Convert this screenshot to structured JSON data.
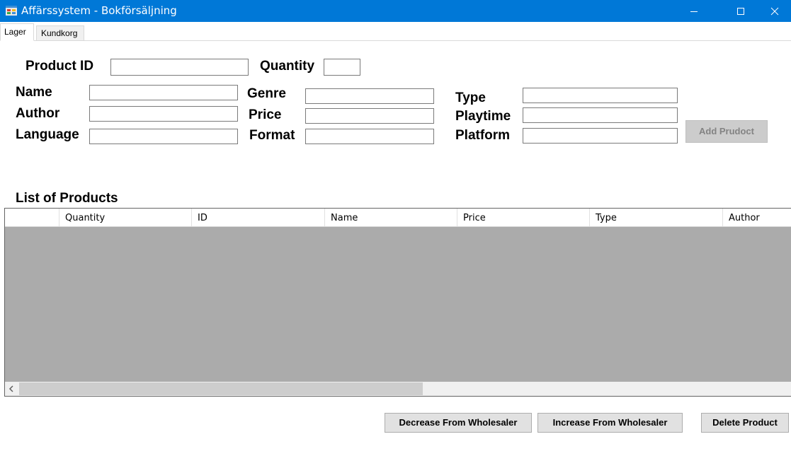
{
  "window": {
    "title": "Affärssystem - Bokförsäljning",
    "icon": "app-form-icon",
    "controls": [
      "minimize-icon",
      "maximize-icon",
      "close-icon"
    ]
  },
  "tabs": [
    {
      "label": "Lager",
      "active": true
    },
    {
      "label": "Kundkorg",
      "active": false
    }
  ],
  "form": {
    "product_id": {
      "label": "Product ID",
      "value": ""
    },
    "quantity": {
      "label": "Quantity",
      "value": ""
    },
    "name": {
      "label": "Name",
      "value": ""
    },
    "author": {
      "label": "Author",
      "value": ""
    },
    "language": {
      "label": "Language",
      "value": ""
    },
    "genre": {
      "label": "Genre",
      "value": ""
    },
    "price": {
      "label": "Price",
      "value": ""
    },
    "format": {
      "label": "Format",
      "value": ""
    },
    "type": {
      "label": "Type",
      "value": ""
    },
    "playtime": {
      "label": "Playtime",
      "value": ""
    },
    "platform": {
      "label": "Platform",
      "value": ""
    },
    "add_button": "Add Prudoct"
  },
  "products": {
    "heading": "List of Products",
    "columns": [
      "",
      "Quantity",
      "ID",
      "Name",
      "Price",
      "Type",
      "Author"
    ],
    "rows": []
  },
  "actions": {
    "decrease": "Decrease From Wholesaler",
    "increase": "Increase From Wholesaler",
    "delete": "Delete Product"
  },
  "colors": {
    "titlebar": "#0078d7",
    "grid_background": "#ababab",
    "button": "#e1e1e1"
  }
}
